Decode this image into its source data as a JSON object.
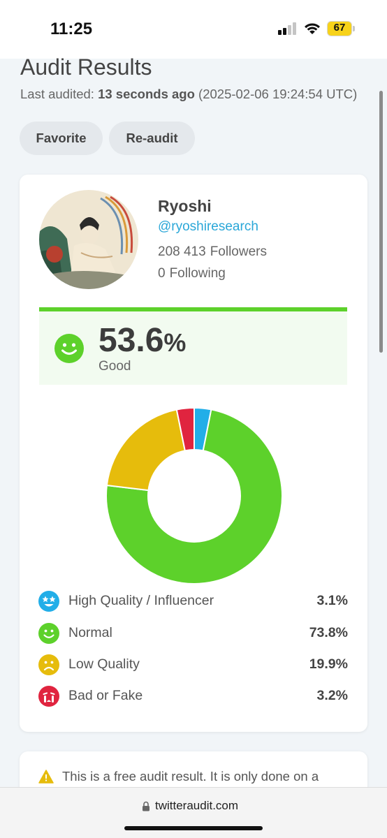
{
  "status_bar": {
    "time": "11:25",
    "battery": "67",
    "icons": [
      "signal-icon",
      "wifi-icon",
      "battery-icon"
    ]
  },
  "page": {
    "title": "Audit Results",
    "last_audited_prefix": "Last audited: ",
    "last_audited_relative": "13 seconds ago",
    "last_audited_absolute": " (2025-02-06 19:24:54 UTC)",
    "buttons": {
      "favorite": "Favorite",
      "reaudit": "Re-audit"
    }
  },
  "profile": {
    "name": "Ryoshi",
    "handle": "@ryoshiresearch",
    "followers_count": "208 413",
    "followers_label": "Followers",
    "following_count": "0",
    "following_label": "Following"
  },
  "score": {
    "value": "53.6",
    "unit": "%",
    "label": "Good",
    "icon": "smile-icon",
    "color": "#5dd12b"
  },
  "chart_data": {
    "type": "pie",
    "categories": [
      "High Quality / Influencer",
      "Normal",
      "Low Quality",
      "Bad or Fake"
    ],
    "values": [
      3.1,
      73.8,
      19.9,
      3.2
    ],
    "colors": [
      "#22aee8",
      "#5dd12b",
      "#e6bc0c",
      "#e0243f"
    ],
    "donut": true
  },
  "legend": [
    {
      "label": "High Quality / Influencer",
      "value": "3.1%",
      "icon": "star-eyes-icon",
      "color": "#22aee8"
    },
    {
      "label": "Normal",
      "value": "73.8%",
      "icon": "smile-icon",
      "color": "#5dd12b"
    },
    {
      "label": "Low Quality",
      "value": "19.9%",
      "icon": "frown-icon",
      "color": "#e6bc0c"
    },
    {
      "label": "Bad or Fake",
      "value": "3.2%",
      "icon": "crying-icon",
      "color": "#e0243f"
    }
  ],
  "notice": {
    "icon": "warning-icon",
    "text": "This is a free audit result. It is only done on a"
  },
  "browser": {
    "url": "twitteraudit.com",
    "icon": "lock-icon"
  }
}
